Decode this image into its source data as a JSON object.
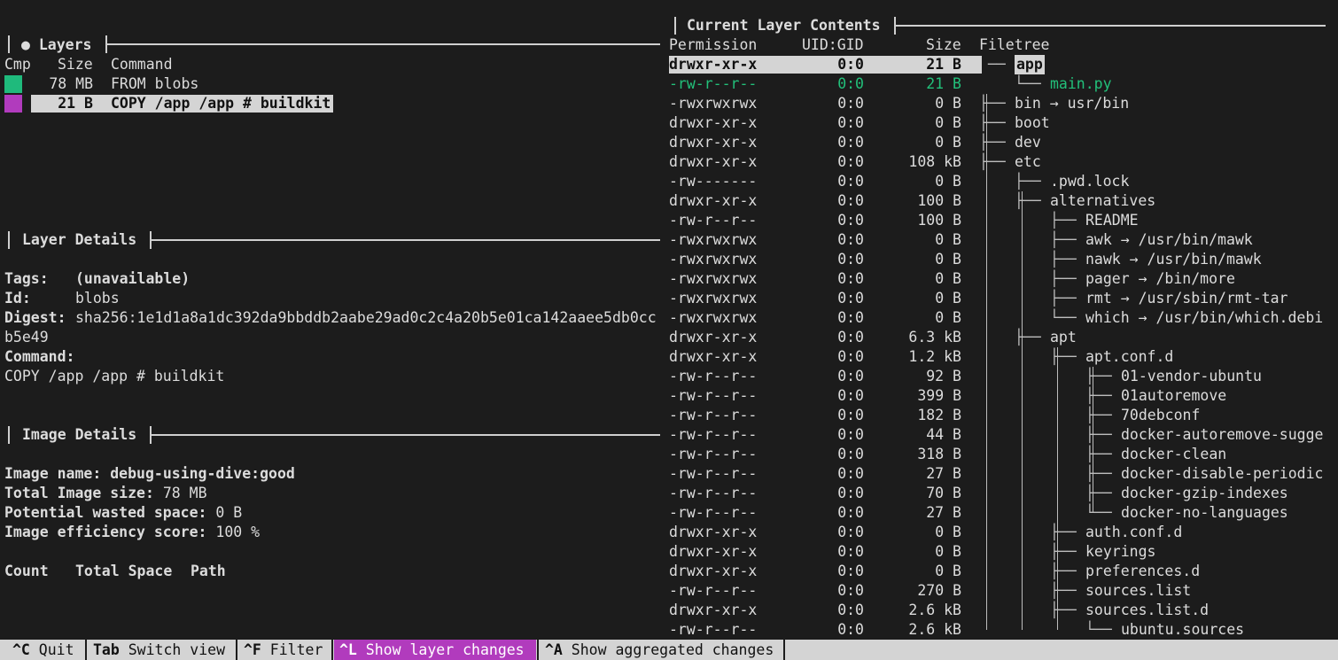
{
  "layers_panel": {
    "title": "● Layers",
    "headers": {
      "cmp": "Cmp",
      "size": "Size",
      "command": "Command"
    },
    "rows": [
      {
        "size": "78 MB",
        "command": "FROM blobs",
        "color": "#1fba7c"
      },
      {
        "size": "21 B",
        "command": "COPY /app /app # buildkit",
        "color": "#b13bbd"
      }
    ]
  },
  "layer_details": {
    "title": "Layer Details",
    "tags_label": "Tags:",
    "tags_value": "(unavailable)",
    "id_label": "Id:",
    "id_value": "blobs",
    "digest_label": "Digest:",
    "digest_value_1": "sha256:1e1d1a8a1dc392da9bbddb2aabe29ad0c2c4a20b5e01ca142aaee5db0cc",
    "digest_value_2": "b5e49",
    "command_label": "Command:",
    "command_value": "COPY /app /app # buildkit"
  },
  "image_details": {
    "title": "Image Details",
    "name_label": "Image name:",
    "name_value": "debug-using-dive:good",
    "size_label": "Total Image size:",
    "size_value": "78 MB",
    "wasted_label": "Potential wasted space:",
    "wasted_value": "0 B",
    "efficiency_label": "Image efficiency score:",
    "efficiency_value": "100 %",
    "table_headers": {
      "count": "Count",
      "total": "Total Space",
      "path": "Path"
    }
  },
  "contents_panel": {
    "title": "Current Layer Contents",
    "headers": {
      "perm": "Permission",
      "uid": "UID:GID",
      "size": "Size",
      "tree": "Filetree"
    },
    "rows": [
      {
        "perm": "drwxr-xr-x",
        "uid": "0:0",
        "size": "21 B",
        "prefix": "──",
        "name": "app"
      },
      {
        "perm": "-rw-r--r--",
        "uid": "0:0",
        "size": "21 B",
        "prefix": "└──",
        "name": "main.py"
      },
      {
        "perm": "-rwxrwxrwx",
        "uid": "0:0",
        "size": "0 B",
        "prefix": "├──",
        "name": "bin → usr/bin"
      },
      {
        "perm": "drwxr-xr-x",
        "uid": "0:0",
        "size": "0 B",
        "prefix": "├──",
        "name": "boot"
      },
      {
        "perm": "drwxr-xr-x",
        "uid": "0:0",
        "size": "0 B",
        "prefix": "├──",
        "name": "dev"
      },
      {
        "perm": "drwxr-xr-x",
        "uid": "0:0",
        "size": "108 kB",
        "prefix": "├──",
        "name": "etc"
      },
      {
        "perm": "-rw-------",
        "uid": "0:0",
        "size": "0 B",
        "prefix": "├──",
        "name": ".pwd.lock"
      },
      {
        "perm": "drwxr-xr-x",
        "uid": "0:0",
        "size": "100 B",
        "prefix": "├──",
        "name": "alternatives"
      },
      {
        "perm": "-rw-r--r--",
        "uid": "0:0",
        "size": "100 B",
        "prefix": "├──",
        "name": "README"
      },
      {
        "perm": "-rwxrwxrwx",
        "uid": "0:0",
        "size": "0 B",
        "prefix": "├──",
        "name": "awk → /usr/bin/mawk"
      },
      {
        "perm": "-rwxrwxrwx",
        "uid": "0:0",
        "size": "0 B",
        "prefix": "├──",
        "name": "nawk → /usr/bin/mawk"
      },
      {
        "perm": "-rwxrwxrwx",
        "uid": "0:0",
        "size": "0 B",
        "prefix": "├──",
        "name": "pager → /bin/more"
      },
      {
        "perm": "-rwxrwxrwx",
        "uid": "0:0",
        "size": "0 B",
        "prefix": "├──",
        "name": "rmt → /usr/sbin/rmt-tar"
      },
      {
        "perm": "-rwxrwxrwx",
        "uid": "0:0",
        "size": "0 B",
        "prefix": "└──",
        "name": "which → /usr/bin/which.debi"
      },
      {
        "perm": "drwxr-xr-x",
        "uid": "0:0",
        "size": "6.3 kB",
        "prefix": "├──",
        "name": "apt"
      },
      {
        "perm": "drwxr-xr-x",
        "uid": "0:0",
        "size": "1.2 kB",
        "prefix": "├──",
        "name": "apt.conf.d"
      },
      {
        "perm": "-rw-r--r--",
        "uid": "0:0",
        "size": "92 B",
        "prefix": "├──",
        "name": "01-vendor-ubuntu"
      },
      {
        "perm": "-rw-r--r--",
        "uid": "0:0",
        "size": "399 B",
        "prefix": "├──",
        "name": "01autoremove"
      },
      {
        "perm": "-rw-r--r--",
        "uid": "0:0",
        "size": "182 B",
        "prefix": "├──",
        "name": "70debconf"
      },
      {
        "perm": "-rw-r--r--",
        "uid": "0:0",
        "size": "44 B",
        "prefix": "├──",
        "name": "docker-autoremove-sugge"
      },
      {
        "perm": "-rw-r--r--",
        "uid": "0:0",
        "size": "318 B",
        "prefix": "├──",
        "name": "docker-clean"
      },
      {
        "perm": "-rw-r--r--",
        "uid": "0:0",
        "size": "27 B",
        "prefix": "├──",
        "name": "docker-disable-periodic"
      },
      {
        "perm": "-rw-r--r--",
        "uid": "0:0",
        "size": "70 B",
        "prefix": "├──",
        "name": "docker-gzip-indexes"
      },
      {
        "perm": "-rw-r--r--",
        "uid": "0:0",
        "size": "27 B",
        "prefix": "└──",
        "name": "docker-no-languages"
      },
      {
        "perm": "drwxr-xr-x",
        "uid": "0:0",
        "size": "0 B",
        "prefix": "├──",
        "name": "auth.conf.d"
      },
      {
        "perm": "drwxr-xr-x",
        "uid": "0:0",
        "size": "0 B",
        "prefix": "├──",
        "name": "keyrings"
      },
      {
        "perm": "drwxr-xr-x",
        "uid": "0:0",
        "size": "0 B",
        "prefix": "├──",
        "name": "preferences.d"
      },
      {
        "perm": "-rw-r--r--",
        "uid": "0:0",
        "size": "270 B",
        "prefix": "├──",
        "name": "sources.list"
      },
      {
        "perm": "drwxr-xr-x",
        "uid": "0:0",
        "size": "2.6 kB",
        "prefix": "├──",
        "name": "sources.list.d"
      },
      {
        "perm": "-rw-r--r--",
        "uid": "0:0",
        "size": "2.6 kB",
        "prefix": "└──",
        "name": "ubuntu.sources"
      }
    ]
  },
  "statusbar": [
    {
      "key": "^C",
      "label": " Quit"
    },
    {
      "key": "Tab",
      "label": " Switch view"
    },
    {
      "key": "^F",
      "label": " Filter"
    },
    {
      "key": "^L",
      "label": " Show layer changes"
    },
    {
      "key": "^A",
      "label": " Show aggregated changes"
    }
  ],
  "colors": {
    "added": "#22c07a",
    "active_key": "#b13bbd",
    "layer1": "#1fba7c",
    "layer2": "#b13bbd"
  }
}
